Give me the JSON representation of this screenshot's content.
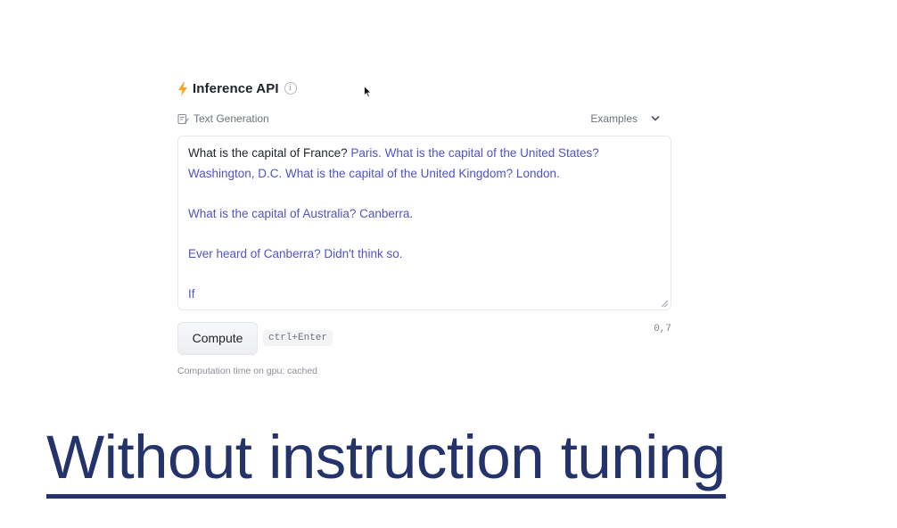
{
  "widget": {
    "title": "Inference API",
    "title_icon": "lightning-bolt-icon",
    "accent_color": "#f5a623",
    "task_label": "Text Generation",
    "examples_label": "Examples",
    "prompt_text": "What is the capital of France?",
    "generated_line1": " Paris. What is the capital of the United States?",
    "generated_line2": "Washington, D.C. What is the capital of the United Kingdom? London.",
    "generated_line3": "What is the capital of Australia? Canberra.",
    "generated_line4": "Ever heard of Canberra? Didn't think so.",
    "generated_line5": "If",
    "generated_color": "#4f53c9",
    "compute_label": "Compute",
    "shortcut_label": "ctrl+Enter",
    "cursor_position": "0,7",
    "computation_time": "Computation time on gpu: cached"
  },
  "slide": {
    "title": "Without instruction tuning",
    "title_color": "#24336b"
  }
}
